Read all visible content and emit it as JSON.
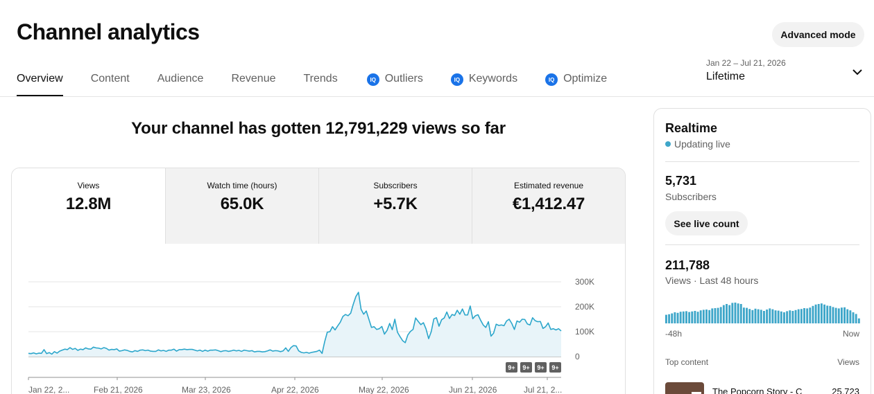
{
  "header": {
    "title": "Channel analytics",
    "advanced_mode_label": "Advanced mode"
  },
  "tabs": [
    {
      "label": "Overview",
      "active": true
    },
    {
      "label": "Content"
    },
    {
      "label": "Audience"
    },
    {
      "label": "Revenue"
    },
    {
      "label": "Trends"
    },
    {
      "label": "Outliers",
      "icon": "vidiq-icon"
    },
    {
      "label": "Keywords",
      "icon": "vidiq-icon"
    },
    {
      "label": "Optimize",
      "icon": "vidiq-icon"
    }
  ],
  "tab_icon_text": "IQ",
  "date_range": {
    "range": "Jan 22 – Jul 21, 2026",
    "period": "Lifetime"
  },
  "headline": "Your channel has gotten 12,791,229 views so far",
  "metrics": [
    {
      "label": "Views",
      "value": "12.8M"
    },
    {
      "label": "Watch time (hours)",
      "value": "65.0K"
    },
    {
      "label": "Subscribers",
      "value": "+5.7K"
    },
    {
      "label": "Estimated revenue",
      "value": "€1,412.47"
    }
  ],
  "chart_data": {
    "type": "area",
    "series": [
      {
        "values": [
          13000,
          12000,
          15000,
          11000,
          14000,
          13000,
          28000,
          12000,
          16000,
          10000,
          20000,
          14000,
          22000,
          26000,
          30000,
          28000,
          36000,
          29000,
          33000,
          25000,
          30000,
          28000,
          35000,
          31000,
          30000,
          38000,
          35000,
          34000,
          31000,
          36000,
          33000,
          26000,
          29000,
          28000,
          31000,
          22000,
          24000,
          27000,
          25000,
          21000,
          19000,
          24000,
          21000,
          26000,
          27000,
          24000,
          26000,
          22000,
          21000,
          21000,
          27000,
          23000,
          25000,
          21000,
          26000,
          26000,
          30000,
          22000,
          28000,
          28000,
          30000,
          28000,
          29000,
          29000,
          26000,
          23000,
          26000,
          21000,
          26000,
          22000,
          26000,
          26000,
          27000,
          24000,
          20000,
          23000,
          24000,
          21000,
          23000,
          26000,
          23000,
          25000,
          21000,
          26000,
          24000,
          22000,
          24000,
          19000,
          21000,
          21000,
          19000,
          20000,
          23000,
          27000,
          22000,
          24000,
          23000,
          20000,
          23000,
          35000,
          21000,
          36000,
          44000,
          43000,
          23000,
          17000,
          15000,
          17000,
          14000,
          17000,
          19000,
          21000,
          26000,
          13000,
          60000,
          98000,
          100000,
          120000,
          107000,
          123000,
          138000,
          161000,
          169000,
          164000,
          174000,
          210000,
          241000,
          258000,
          190000,
          170000,
          183000,
          150000,
          117000,
          120000,
          109000,
          112000,
          121000,
          90000,
          105000,
          133000,
          108000,
          150000,
          98000,
          80000,
          64000,
          56000,
          87000,
          101000,
          109000,
          155000,
          141000,
          128000,
          136000,
          111000,
          72000,
          100000,
          151000,
          156000,
          122000,
          148000,
          155000,
          179000,
          153000,
          169000,
          165000,
          186000,
          170000,
          191000,
          167000,
          167000,
          203000,
          152000,
          164000,
          168000,
          146000,
          127000,
          117000,
          140000,
          82000,
          94000,
          130000,
          125000,
          127000,
          124000,
          143000,
          150000,
          133000,
          109000,
          143000,
          138000,
          150000,
          149000,
          131000,
          127000,
          156000,
          144000,
          140000,
          141000,
          113000,
          120000,
          135000,
          109000,
          112000,
          107000,
          112000,
          103000
        ]
      }
    ],
    "x_tick_labels": [
      "Jan 22, 2...",
      "Feb 21, 2026",
      "Mar 23, 2026",
      "Apr 22, 2026",
      "May 22, 2026",
      "Jun 21, 2026",
      "Jul 21, 2..."
    ],
    "y_tick_labels": [
      "300K",
      "200K",
      "100K",
      "0"
    ],
    "ylim": [
      0,
      300000
    ],
    "badges": [
      "9+",
      "9+",
      "9+",
      "9+"
    ],
    "line_color": "#2ba6cb",
    "fill_color": "#e8f4f9"
  },
  "realtime": {
    "title": "Realtime",
    "status": "Updating live",
    "subscribers_value": "5,731",
    "subscribers_label": "Subscribers",
    "live_count_button": "See live count",
    "views_value": "211,788",
    "views_label": "Views · Last 48 hours",
    "hourly_bars": [
      0.31,
      0.33,
      0.36,
      0.4,
      0.38,
      0.42,
      0.43,
      0.44,
      0.41,
      0.43,
      0.45,
      0.42,
      0.47,
      0.49,
      0.5,
      0.48,
      0.54,
      0.55,
      0.56,
      0.59,
      0.66,
      0.7,
      0.66,
      0.74,
      0.75,
      0.72,
      0.7,
      0.57,
      0.56,
      0.52,
      0.48,
      0.53,
      0.51,
      0.49,
      0.45,
      0.5,
      0.54,
      0.51,
      0.47,
      0.46,
      0.43,
      0.4,
      0.44,
      0.47,
      0.45,
      0.48,
      0.51,
      0.52,
      0.55,
      0.54,
      0.57,
      0.63,
      0.68,
      0.7,
      0.72,
      0.68,
      0.64,
      0.63,
      0.59,
      0.56,
      0.54,
      0.57,
      0.58,
      0.51,
      0.47,
      0.4,
      0.34,
      0.18
    ],
    "axis_start": "-48h",
    "axis_end": "Now",
    "top_content_label": "Top content",
    "top_content_views_label": "Views",
    "top_video_title": "The Popcorn Story - C",
    "top_video_views": "25,723",
    "bar_color": "#3ea6c9"
  }
}
